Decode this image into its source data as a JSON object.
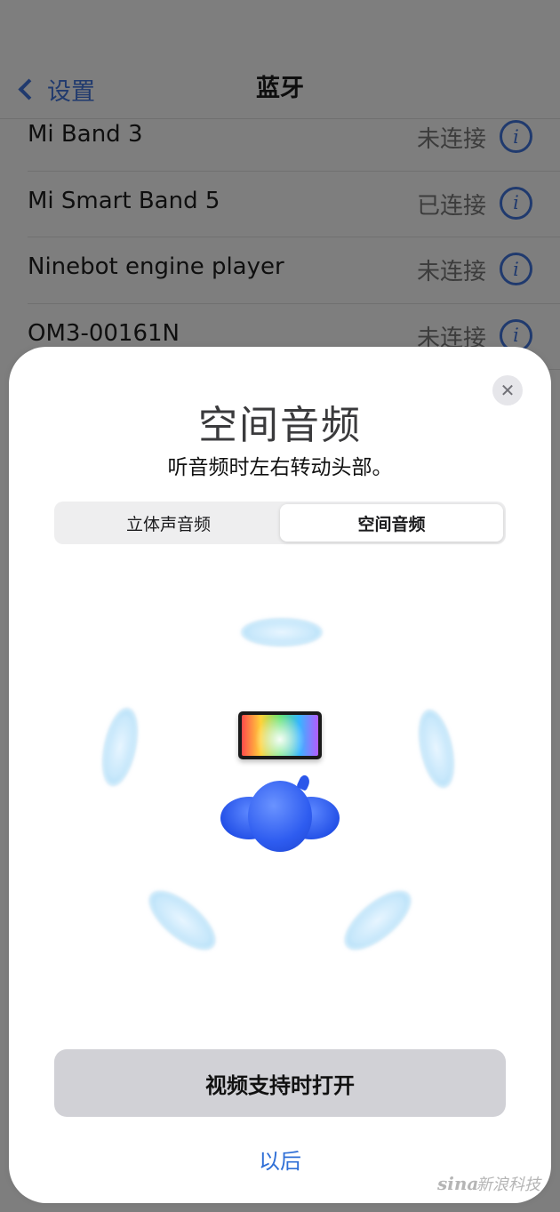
{
  "nav": {
    "back_label": "设置",
    "title": "蓝牙"
  },
  "devices": [
    {
      "name": "Mi Band 3",
      "status": "未连接"
    },
    {
      "name": "Mi Smart Band 5",
      "status": "已连接"
    },
    {
      "name": "Ninebot engine player",
      "status": "未连接"
    },
    {
      "name": "OM3-00161N",
      "status": "未连接"
    }
  ],
  "sheet": {
    "title": "空间音频",
    "subtitle": "听音频时左右转动头部。",
    "segments": [
      "立体声音频",
      "空间音频"
    ],
    "selected_segment": "空间音频",
    "primary_button": "视频支持时打开",
    "secondary_link": "以后"
  },
  "watermark": {
    "text": "sina 新浪科技"
  },
  "colors": {
    "accent": "#2f6fd6",
    "head": "#2e5cf0",
    "speaker": "#a9dbf7"
  }
}
